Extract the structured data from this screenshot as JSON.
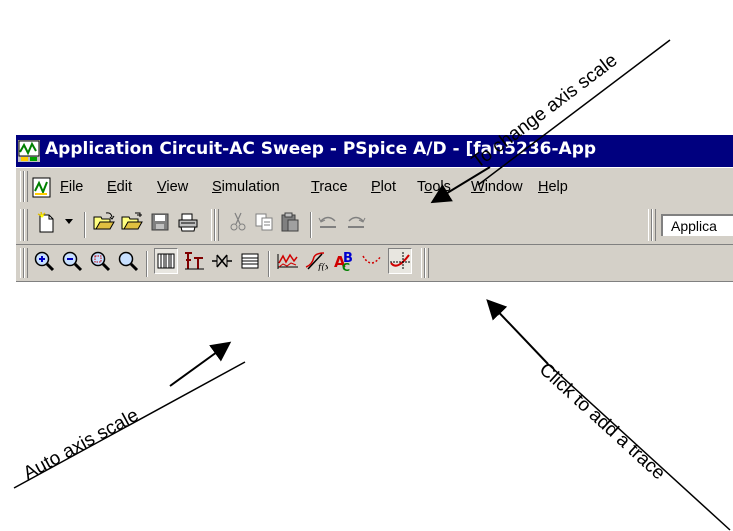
{
  "window": {
    "title": "Application Circuit-AC Sweep - PSpice A/D  - [fan5236-App"
  },
  "menubar": {
    "items": [
      {
        "label": "File",
        "accel": "F",
        "rest": "ile"
      },
      {
        "label": "Edit",
        "accel": "E",
        "rest": "dit"
      },
      {
        "label": "View",
        "accel": "V",
        "rest": "iew"
      },
      {
        "label": "Simulation",
        "accel": "S",
        "rest": "imulation"
      },
      {
        "label": "Trace",
        "accel": "T",
        "rest": "race"
      },
      {
        "label": "Plot",
        "accel": "P",
        "rest": "lot"
      },
      {
        "label": "Tools",
        "accel": "o",
        "pre": "T",
        "rest": "ols"
      },
      {
        "label": "Window",
        "accel": "W",
        "rest": "indow"
      },
      {
        "label": "Help",
        "accel": "H",
        "rest": "elp"
      }
    ]
  },
  "toolbar1": {
    "profile_value": "Applica",
    "icons": [
      "new-file-icon",
      "dropdown-arrow-icon",
      "open-file-icon",
      "open-folder-icon",
      "save-icon",
      "print-icon",
      "cut-icon",
      "copy-icon",
      "paste-icon",
      "undo-icon",
      "redo-icon"
    ]
  },
  "toolbar2": {
    "icons": [
      "zoom-in-icon",
      "zoom-out-icon",
      "zoom-area-icon",
      "zoom-fit-icon",
      "log-x-icon",
      "fourier-icon",
      "performance-analysis-icon",
      "evaluate-measurement-icon",
      "add-trace-icon",
      "trace-function-icon",
      "mark-label-icon",
      "mark-data-points-icon",
      "toggle-cursor-icon"
    ]
  },
  "annotations": {
    "change_axis": "To change axis scale",
    "auto_axis": "Auto axis scale",
    "add_trace": "Click to add a trace"
  }
}
